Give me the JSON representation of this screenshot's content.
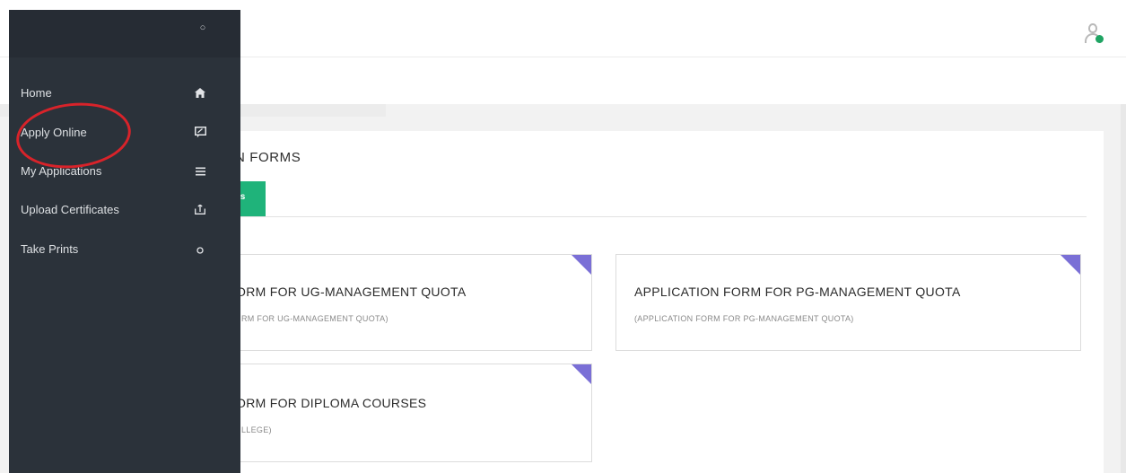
{
  "sidebar": {
    "items": [
      {
        "label": "Home",
        "icon": "home-icon"
      },
      {
        "label": "Apply Online",
        "icon": "apply-form-icon"
      },
      {
        "label": "My Applications",
        "icon": "list-icon"
      },
      {
        "label": "Upload Certificates",
        "icon": "upload-icon"
      },
      {
        "label": "Take Prints",
        "icon": "circle-icon"
      }
    ]
  },
  "main": {
    "section_title": "N FORMS",
    "tab_label": "ıs",
    "cards": [
      {
        "title": "ORM FOR UG-MANAGEMENT QUOTA",
        "subtitle": "RM FOR UG-MANAGEMENT QUOTA)"
      },
      {
        "title": "APPLICATION FORM FOR PG-MANAGEMENT QUOTA",
        "subtitle": "(APPLICATION FORM FOR PG-MANAGEMENT QUOTA)"
      },
      {
        "title": "ORM FOR DIPLOMA COURSES",
        "subtitle": "LLEGE)"
      }
    ]
  },
  "colors": {
    "sidebar_bg": "#2b323a",
    "accent_green": "#1fb37a",
    "corner_purple": "#7a6fd6",
    "highlight_red": "#d8232a",
    "status_green": "#1fa463"
  }
}
